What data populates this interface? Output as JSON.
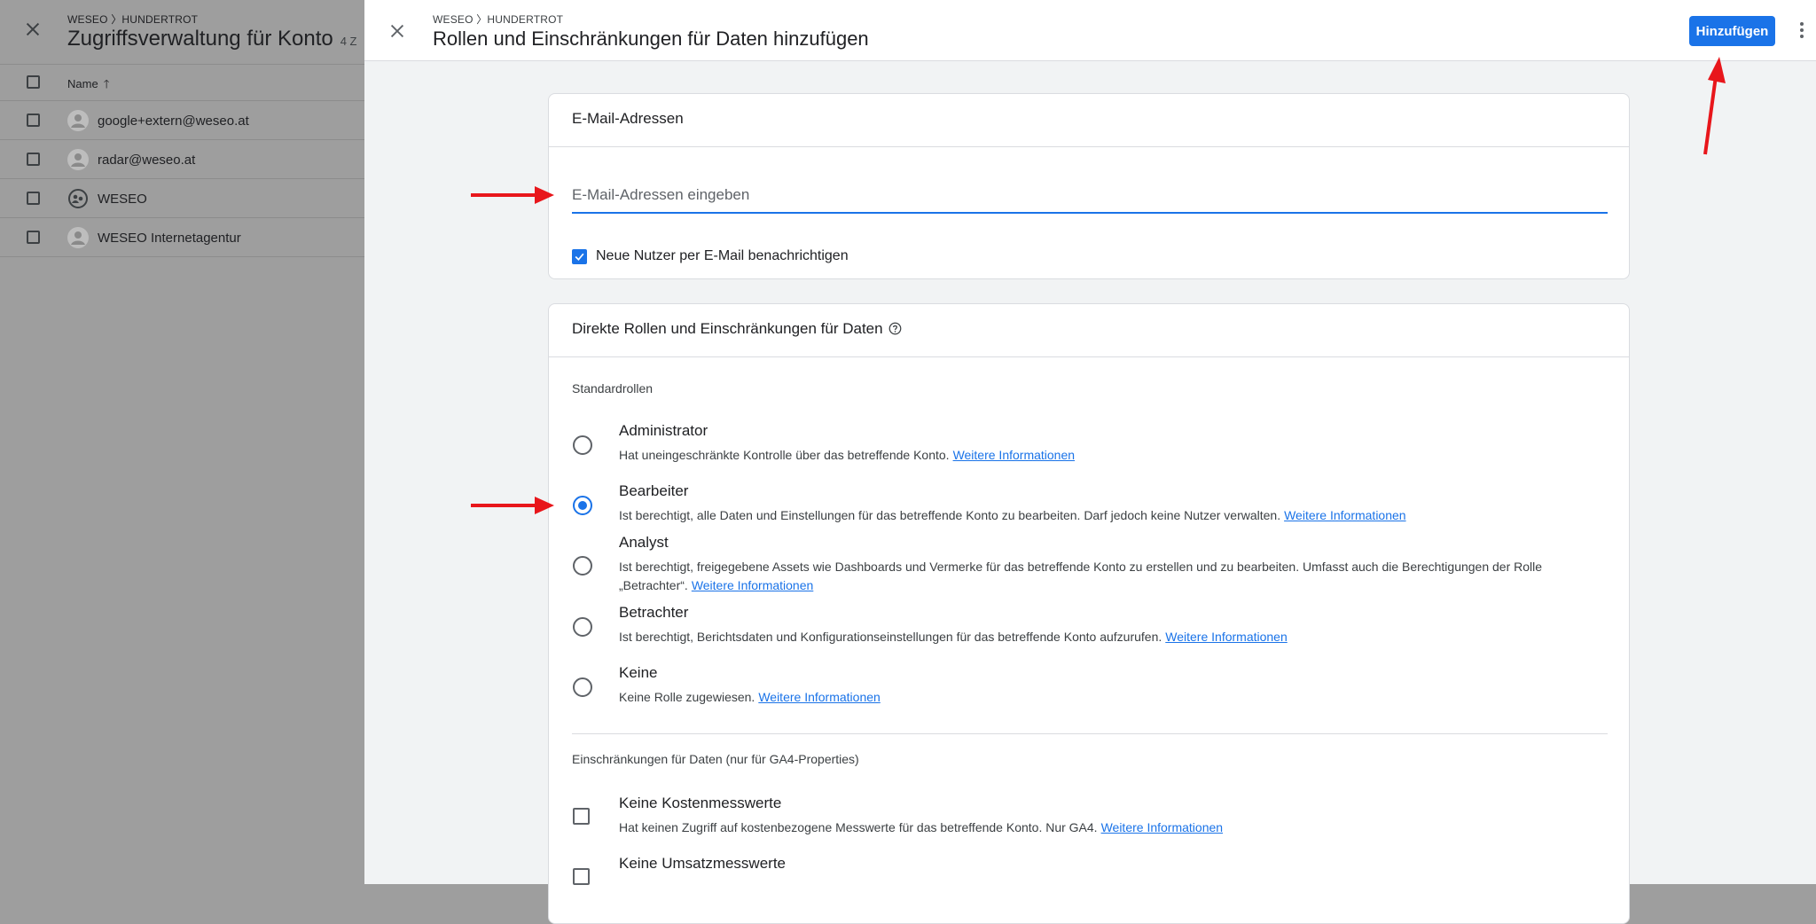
{
  "background": {
    "breadcrumb": "WESEO 〉HUNDERTROT",
    "title": "Zugriffsverwaltung für Konto",
    "count": "4 Z",
    "column_name": "Name",
    "rows": [
      {
        "label": "google+extern@weseo.at"
      },
      {
        "label": "radar@weseo.at"
      },
      {
        "label": "WESEO"
      },
      {
        "label": "WESEO Internetagentur"
      }
    ]
  },
  "dialog": {
    "breadcrumb": "WESEO 〉HUNDERTROT",
    "title": "Rollen und Einschränkungen für Daten hinzufügen",
    "add_button": "Hinzufügen"
  },
  "email_card": {
    "heading": "E-Mail-Adressen",
    "input_placeholder": "E-Mail-Adressen eingeben",
    "input_value": "",
    "notify_label": "Neue Nutzer per E-Mail benachrichtigen",
    "notify_checked": true
  },
  "roles_card": {
    "heading": "Direkte Rollen und Einschränkungen für Daten",
    "standard_roles_label": "Standardrollen",
    "link_text": "Weitere Informationen",
    "roles": [
      {
        "title": "Administrator",
        "desc": "Hat uneingeschränkte Kontrolle über das betreffende Konto.",
        "checked": false
      },
      {
        "title": "Bearbeiter",
        "desc": "Ist berechtigt, alle Daten und Einstellungen für das betreffende Konto zu bearbeiten. Darf jedoch keine Nutzer verwalten.",
        "checked": true
      },
      {
        "title": "Analyst",
        "desc": "Ist berechtigt, freigegebene Assets wie Dashboards und Vermerke für das betreffende Konto zu erstellen und zu bearbeiten. Umfasst auch die Berechtigungen der Rolle „Betrachter“.",
        "checked": false
      },
      {
        "title": "Betrachter",
        "desc": "Ist berechtigt, Berichtsdaten und Konfigurationseinstellungen für das betreffende Konto aufzurufen.",
        "checked": false
      },
      {
        "title": "Keine",
        "desc": "Keine Rolle zugewiesen.",
        "checked": false
      }
    ],
    "restrictions_label": "Einschränkungen für Daten (nur für GA4-Properties)",
    "restrictions": [
      {
        "title": "Keine Kostenmesswerte",
        "desc": "Hat keinen Zugriff auf kostenbezogene Messwerte für das betreffende Konto. Nur GA4.",
        "checked": false
      },
      {
        "title": "Keine Umsatzmesswerte",
        "desc": "",
        "checked": false
      }
    ]
  },
  "colors": {
    "accent": "#1a73e8",
    "annotation_arrow": "#e8161b",
    "overlay": "#9e9e9e"
  }
}
